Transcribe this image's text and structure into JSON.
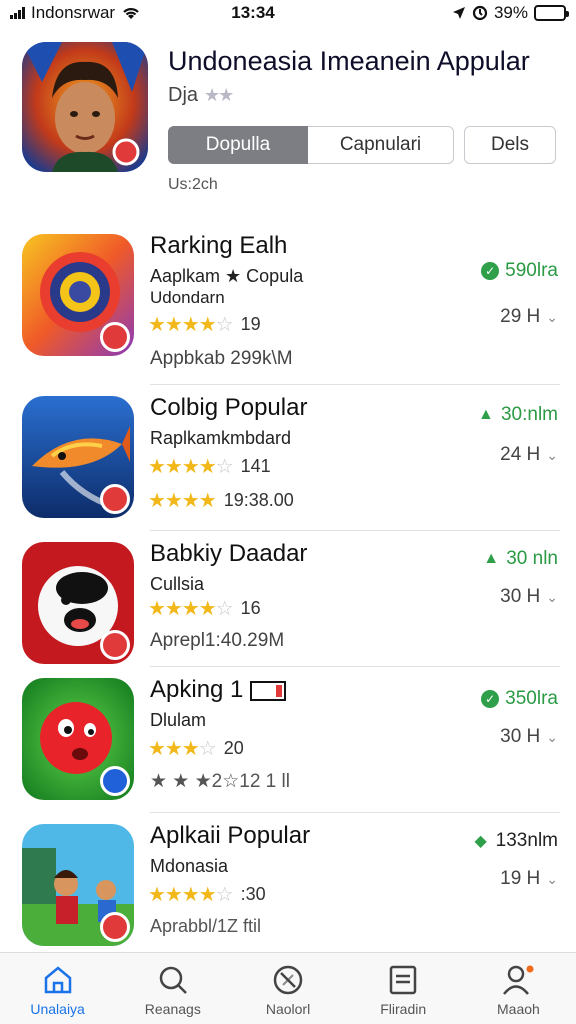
{
  "status_bar": {
    "carrier": "Indonsrwar",
    "time": "13:34",
    "battery": "39%",
    "battery_level": 0.39
  },
  "header": {
    "title": "Undoneasia Imeanein Appular",
    "subtitle": "Dja",
    "stars": "★★",
    "segments": [
      "Dopulla",
      "Capnulari",
      "Dels"
    ],
    "update_text": "Us:2ch"
  },
  "apps": [
    {
      "name": "Rarking Ealh",
      "line1": "Aaplkam ★ Copula",
      "line2": "Udondarn",
      "stars": "★★★★",
      "star_half": "☆",
      "rating_count": "19",
      "meta": "Appbkab 299k\\M",
      "size": "590lra",
      "size_icon": "check",
      "time": "29 H",
      "badge_color": "#e03a3a"
    },
    {
      "name": "Colbig Popular",
      "line1": "Raplkamkmbdard",
      "line2": "",
      "stars": "★★★★",
      "star_half": "☆",
      "rating_count": "141",
      "meta": "19:38.00",
      "meta_stars": "★★★★",
      "size": "30:nlm",
      "size_icon": "tri",
      "time": "24 H",
      "badge_color": "#e03a3a"
    },
    {
      "name": "Babkiy Daadar",
      "line1": "Cullsia",
      "line2": "",
      "stars": "★★★★",
      "star_half": "☆",
      "rating_count": "16",
      "meta": "Aprepl1:40.29M",
      "size": "30 nln",
      "size_icon": "tri",
      "time": "30 H",
      "badge_color": "#e03a3a"
    },
    {
      "name": "Apking 1",
      "line1": "Dlulam",
      "line2": "",
      "stars": "★★★",
      "star_half": "☆",
      "rating_count": "20",
      "meta": "★ ★ ★2☆12 1 ll",
      "size": "350lra",
      "size_icon": "check",
      "time": "30 H",
      "badge_color": "#2060d8"
    },
    {
      "name": "Aplkaii Popular",
      "line1": "Mdonasia",
      "line2": "",
      "stars": "★★★★",
      "star_half": "☆",
      "rating_count": ":30",
      "meta": "Aprabbl/1Z ftil",
      "size": "133nlm",
      "size_icon": "tri",
      "time": "19 H",
      "badge_color": "#e03a3a"
    }
  ],
  "tabs": [
    {
      "label": "Unalaiya",
      "icon": "home-icon",
      "active": true
    },
    {
      "label": "Reanags",
      "icon": "search-icon",
      "active": false
    },
    {
      "label": "Naolorl",
      "icon": "compass-icon",
      "active": false
    },
    {
      "label": "Fliradin",
      "icon": "list-icon",
      "active": false
    },
    {
      "label": "Maaoh",
      "icon": "profile-icon",
      "active": false
    }
  ],
  "colors": {
    "accent": "#1a73e8",
    "green": "#2b9a44",
    "star": "#f2b81a",
    "badge_red": "#e03a3a"
  }
}
